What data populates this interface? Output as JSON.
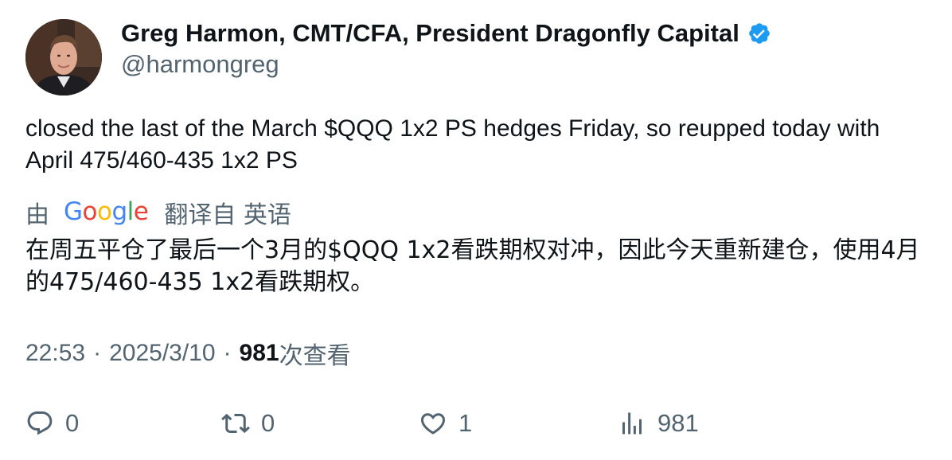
{
  "author": {
    "display_name": "Greg Harmon, CMT/CFA, President Dragonfly Capital",
    "handle": "@harmongreg",
    "verified": true,
    "verified_color": "#1d9bf0"
  },
  "tweet": {
    "text": "closed the last of the March $QQQ 1x2 PS hedges Friday, so reupped today with April 475/460-435 1x2 PS"
  },
  "translation": {
    "by_label": "由",
    "provider": "Google",
    "source_label": "翻译自 英语",
    "text": "在周五平仓了最后一个3月的$QQQ 1x2看跌期权对冲，因此今天重新建仓，使用4月的475/460-435 1x2看跌期权。"
  },
  "meta": {
    "time": "22:53",
    "separator": "·",
    "date": "2025/3/10",
    "views_count": "981",
    "views_label": "次查看"
  },
  "actions": {
    "reply": {
      "icon": "reply-icon",
      "count": "0"
    },
    "retweet": {
      "icon": "retweet-icon",
      "count": "0"
    },
    "like": {
      "icon": "heart-icon",
      "count": "1"
    },
    "views": {
      "icon": "views-icon",
      "count": "981"
    }
  },
  "colors": {
    "text": "#0f1419",
    "secondary": "#536471",
    "google_blue": "#4285F4",
    "google_red": "#EA4335",
    "google_yellow": "#FBBC05",
    "google_green": "#34A853"
  }
}
